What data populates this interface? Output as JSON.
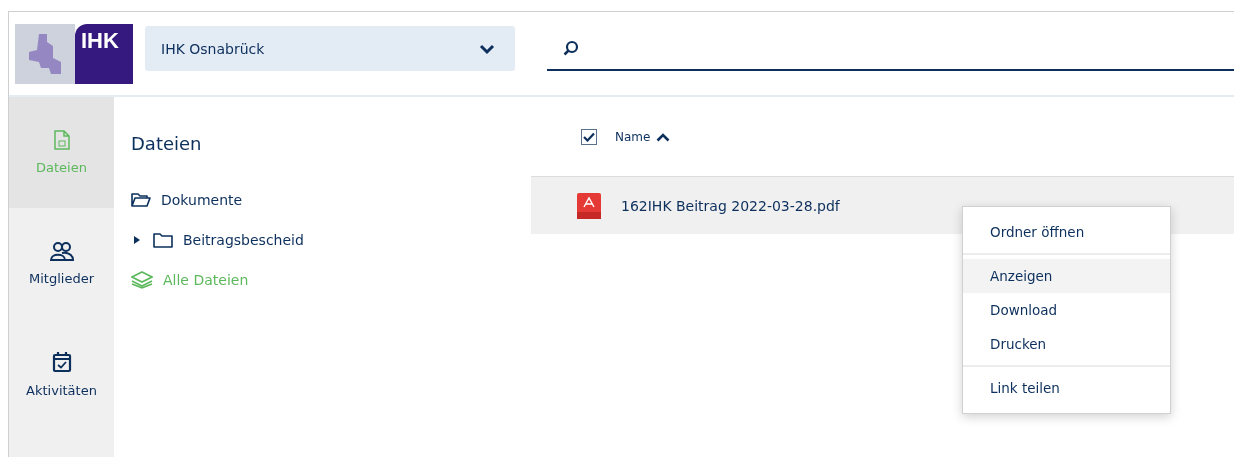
{
  "header": {
    "logo_text": "IHK",
    "organization": "IHK Osnabrück"
  },
  "nav": [
    {
      "label": "Dateien",
      "kind": "file",
      "selected": true
    },
    {
      "label": "Mitglieder",
      "kind": "people",
      "selected": false
    },
    {
      "label": "Aktivitäten",
      "kind": "calendar",
      "selected": false
    }
  ],
  "tree": {
    "title": "Dateien",
    "items": [
      {
        "label": "Dokumente",
        "kind": "folder-open",
        "active": false
      },
      {
        "label": "Beitragsbescheid",
        "kind": "folder",
        "expanded": false,
        "active": false
      },
      {
        "label": "Alle Dateien",
        "kind": "layers",
        "active": true
      }
    ]
  },
  "table": {
    "select_all": {
      "checked": true
    },
    "columns": [
      {
        "label": "Name",
        "sort_ascending": true
      }
    ],
    "rows": [
      {
        "name": "162IHK Beitrag 2022-03-28.pdf",
        "selected": true
      }
    ]
  },
  "context_menu": {
    "groups": [
      [
        {
          "label": "Ordner öffnen",
          "highlighted": false
        }
      ],
      [
        {
          "label": "Anzeigen",
          "highlighted": true
        },
        {
          "label": "Download",
          "highlighted": false
        },
        {
          "label": "Drucken",
          "highlighted": false
        }
      ],
      [
        {
          "label": "Link teilen",
          "highlighted": false
        }
      ]
    ]
  }
}
